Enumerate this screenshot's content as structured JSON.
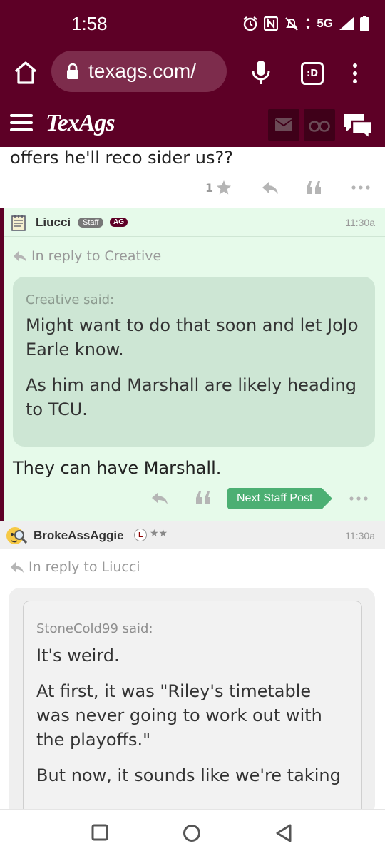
{
  "status_bar": {
    "time": "1:58",
    "network": "5G",
    "icons": [
      "alarm-icon",
      "nfc-icon",
      "mute-icon",
      "data-arrows-icon",
      "signal-icon",
      "battery-icon"
    ]
  },
  "browser": {
    "url": "texags.com/",
    "tab_label": ":D"
  },
  "site": {
    "logo": "TexAgs",
    "brand_color": "#5d0026"
  },
  "posts": {
    "prev": {
      "text": "offers he'll reco sider us??",
      "star_count": "1"
    },
    "staff": {
      "username": "Liucci",
      "badge_staff": "Staff",
      "badge_ag": "AG",
      "time": "11:30a",
      "reply_to": "In reply to Creative",
      "quote_said": "Creative said:",
      "quote_p1": "Might want to do that soon and let JoJo Earle know.",
      "quote_p2": "As him and Marshall are likely heading to TCU.",
      "reply": "They can have Marshall.",
      "next_staff": "Next Staff Post",
      "bg_color": "#e6faea"
    },
    "second": {
      "username": "BrokeAssAggie",
      "badge_l": "L",
      "rank": "★★",
      "time": "11:30a",
      "reply_to": "In reply to Liucci",
      "quote_said": "StoneCold99 said:",
      "quote_p1": "It's weird.",
      "quote_p2": "At first, it was \"Riley's timetable was never going to work out with the playoffs.\"",
      "quote_p3": "But now, it sounds like we're taking"
    }
  }
}
